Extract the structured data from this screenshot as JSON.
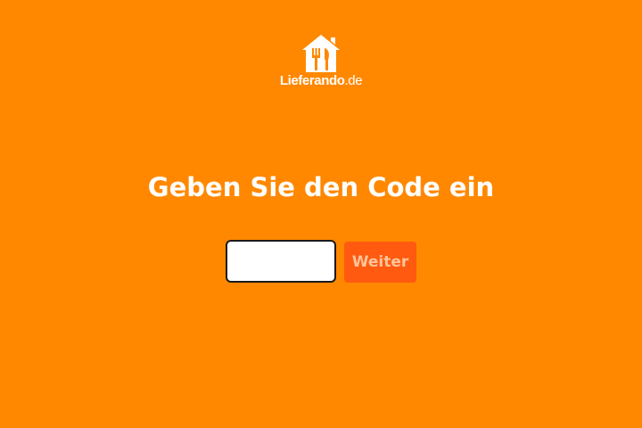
{
  "brand": {
    "name": "Lieferando",
    "tld": ".de",
    "logo_icon": "house-with-cutlery-icon"
  },
  "form": {
    "heading": "Geben Sie den Code ein",
    "code_value": "",
    "submit_label": "Weiter"
  },
  "colors": {
    "background": "#ff8800",
    "button": "#ff5a0f",
    "button_text": "#ffc49a",
    "text": "#ffffff"
  }
}
